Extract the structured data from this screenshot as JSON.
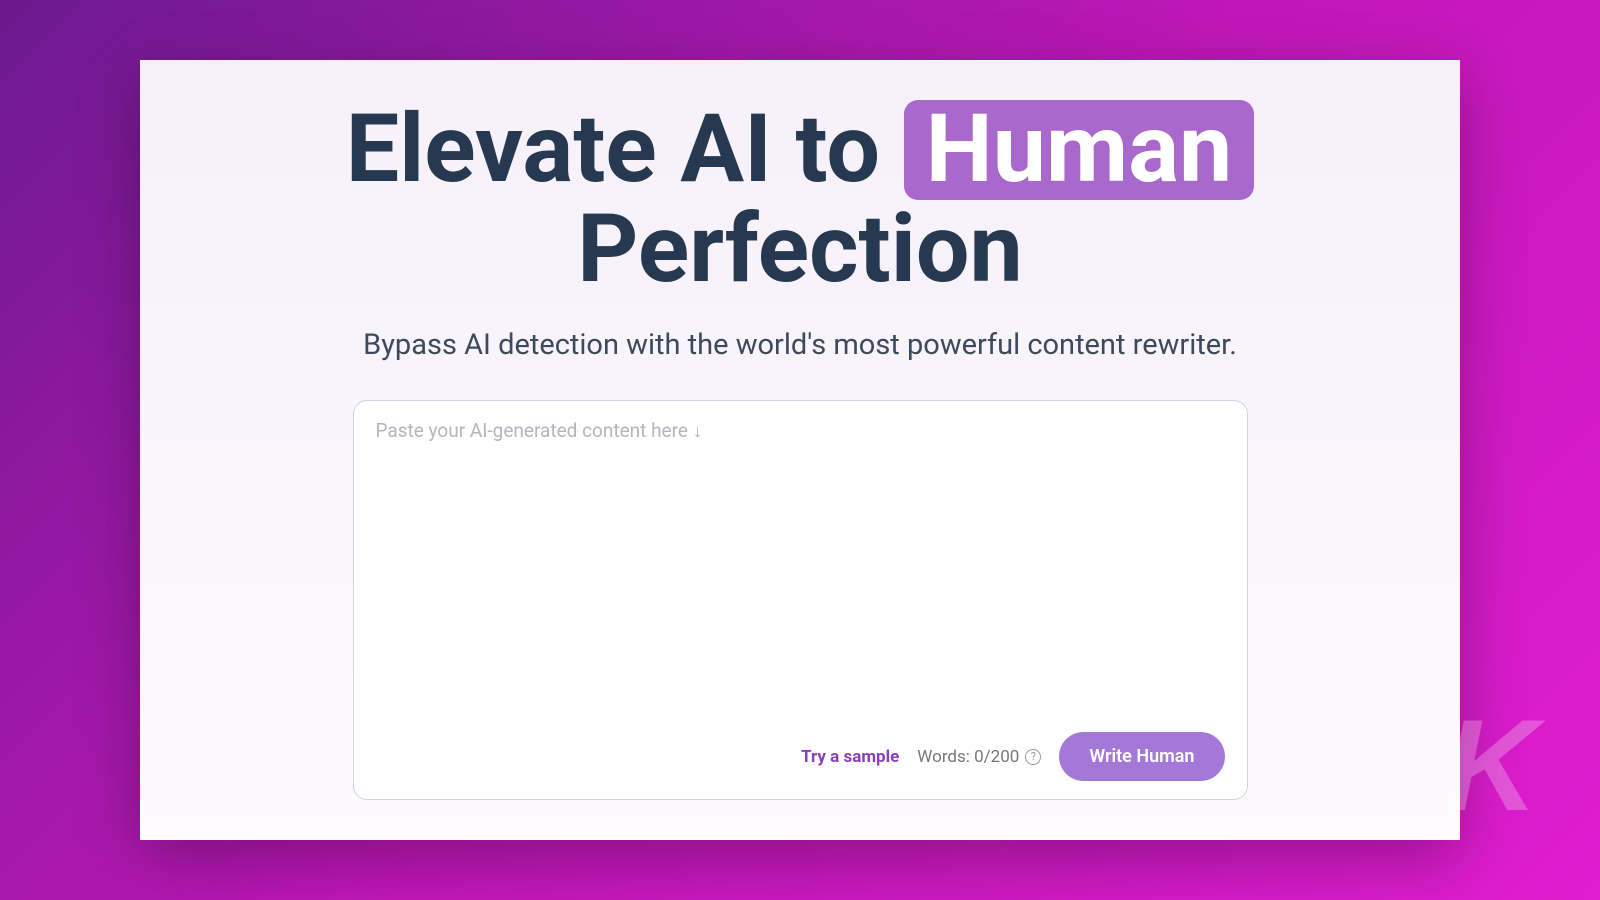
{
  "headline": {
    "part1": "Elevate AI to ",
    "highlight": "Human",
    "part2": "Perfection"
  },
  "subheadline": "Bypass AI detection with the world's most powerful content rewriter.",
  "textarea": {
    "placeholder": "Paste your AI-generated content here ↓"
  },
  "footer": {
    "try_sample": "Try a sample",
    "word_count": "Words: 0/200",
    "write_button": "Write Human"
  },
  "watermark": "K"
}
